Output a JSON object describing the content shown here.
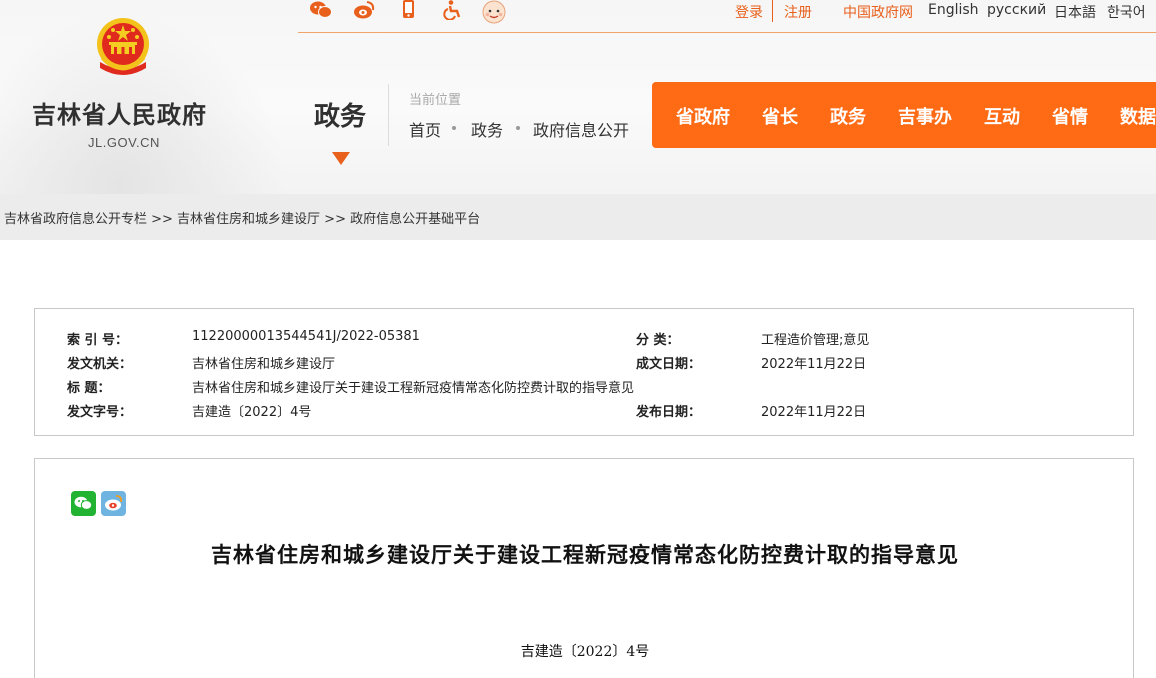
{
  "site": {
    "title": "吉林省人民政府",
    "url": "JL.GOV.CN"
  },
  "top_bar": {
    "icons": [
      "wechat-icon",
      "weibo-icon",
      "mobile-icon",
      "accessibility-icon",
      "baby-icon"
    ],
    "login": "登录",
    "register": "注册",
    "links": [
      "中国政府网",
      "English",
      "русский",
      "日本語",
      "한국어"
    ],
    "accent": "#e8601c"
  },
  "section": {
    "title": "政务",
    "location_label": "当前位置",
    "breadcrumb": [
      "首页",
      "政务",
      "政府信息公开"
    ]
  },
  "nav": {
    "color": "#ff6b14",
    "items": [
      "省政府",
      "省长",
      "政务",
      "吉事办",
      "互动",
      "省情",
      "数据"
    ]
  },
  "strip": {
    "text": "吉林省政府信息公开专栏 >> 吉林省住房和城乡建设厅 >> 政府信息公开基础平台"
  },
  "info": {
    "index_label": "索 引 号：",
    "index_value": "11220000013544541J/2022-05381",
    "category_label": "分    类：",
    "category_value": "工程造价管理;意见",
    "issuer_label": "发文机关：",
    "issuer_value": "吉林省住房和城乡建设厅",
    "date_written_label": "成文日期：",
    "date_written_value": "2022年11月22日",
    "title_label": "标      题：",
    "title_value": "吉林省住房和城乡建设厅关于建设工程新冠疫情常态化防控费计取的指导意见",
    "docno_label": "发文字号：",
    "docno_value": "吉建造〔2022〕4号",
    "publish_label": "发布日期：",
    "publish_value": "2022年11月22日"
  },
  "article": {
    "share_icons": [
      "wechat-share-icon",
      "weibo-share-icon"
    ],
    "title": "吉林省住房和城乡建设厅关于建设工程新冠疫情常态化防控费计取的指导意见",
    "doc_no": "吉建造〔2022〕4号"
  }
}
